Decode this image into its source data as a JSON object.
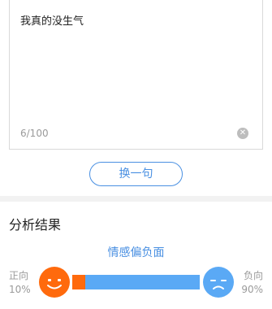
{
  "input": {
    "text": "我真的没生气",
    "count": "6/100",
    "clear_icon": "clear-icon"
  },
  "actions": {
    "switch_label": "换一句"
  },
  "result": {
    "section_title": "分析结果",
    "sentiment": "情感偏负面",
    "positive": {
      "label": "正向",
      "percent": "10%",
      "fraction": 0.1,
      "color": "#ff6a0d"
    },
    "negative": {
      "label": "负向",
      "percent": "90%",
      "fraction": 0.9,
      "color": "#5aa9f5"
    }
  },
  "colors": {
    "accent": "#4a90e2",
    "divider": "#f2f2f2"
  }
}
